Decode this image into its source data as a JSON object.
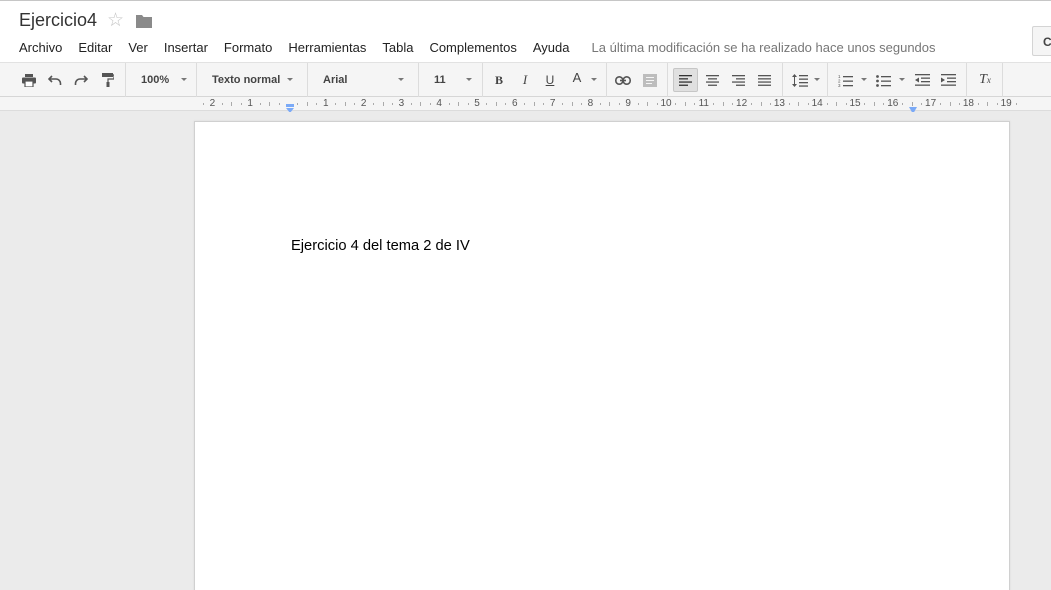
{
  "document": {
    "title": "Ejercicio4",
    "body_text": "Ejercicio 4 del tema 2 de IV"
  },
  "header": {
    "star_icon": "star-outline-icon",
    "folder_icon": "folder-icon",
    "share_label": "C"
  },
  "menu": {
    "items": [
      "Archivo",
      "Editar",
      "Ver",
      "Insertar",
      "Formato",
      "Herramientas",
      "Tabla",
      "Complementos",
      "Ayuda"
    ],
    "save_status": "La última modificación se ha realizado hace unos segundos"
  },
  "toolbar": {
    "zoom": "100%",
    "style": "Texto normal",
    "font": "Arial",
    "font_size": "11",
    "bold_label": "B",
    "italic_label": "I",
    "underline_label": "U",
    "text_color_label": "A",
    "clear_format_label": "T",
    "clear_format_sub": "x",
    "text_color": "#000000",
    "active_alignment": "left"
  },
  "ruler": {
    "labels": [
      "2",
      "1",
      "1",
      "2",
      "3",
      "4",
      "5",
      "6",
      "7",
      "8",
      "9",
      "10",
      "11",
      "12",
      "13",
      "14",
      "15",
      "16",
      "17",
      "18",
      "19"
    ]
  },
  "colors": {
    "accent_blue": "#7baaf7",
    "page_background": "#ffffff",
    "canvas_background": "#ebebeb"
  }
}
